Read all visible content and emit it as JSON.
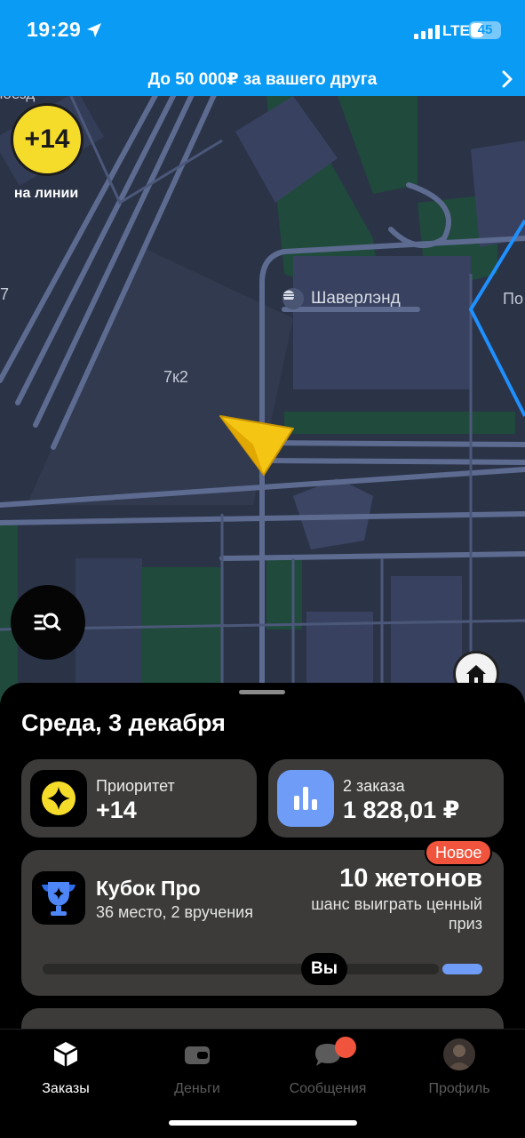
{
  "status_bar": {
    "time": "19:29",
    "network": "LTE",
    "battery": "45",
    "battery_level": 0.45
  },
  "banner": {
    "text": "До 50 000₽ за вашего друга"
  },
  "map": {
    "poi_name": "Шаверлэнд",
    "building_label": "7к2",
    "edge_label_left": "7",
    "edge_label_right": "По",
    "edge_label_top": "ноезд",
    "priority_badge": "+14",
    "priority_badge_label": "на линии"
  },
  "sheet": {
    "date": "Среда, 3 декабря",
    "priority_card": {
      "label": "Приоритет",
      "value": "+14"
    },
    "orders_card": {
      "label": "2 заказа",
      "value": "1 828,01 ₽"
    },
    "cup_card": {
      "badge": "Новое",
      "title": "Кубок Про",
      "subtitle": "36 место, 2 вручения",
      "tokens": "10 жетонов",
      "chance": "шанс выиграть ценный приз",
      "you_marker": "Вы"
    }
  },
  "tabbar": {
    "tabs": [
      {
        "label": "Заказы",
        "icon": "cube-icon",
        "active": true
      },
      {
        "label": "Деньги",
        "icon": "wallet-icon",
        "active": false
      },
      {
        "label": "Сообщения",
        "icon": "chat-bubble-icon",
        "active": false
      },
      {
        "label": "Профиль",
        "icon": "avatar",
        "active": false
      }
    ]
  },
  "colors": {
    "banner_blue": "#0a9bf5",
    "accent_yellow": "#f6dc2a",
    "accent_red": "#f0543d",
    "accent_blue": "#6f9cf6",
    "card_bg": "#3c3b39"
  }
}
